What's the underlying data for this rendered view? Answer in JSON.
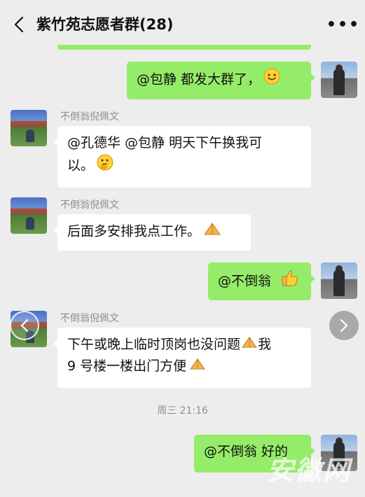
{
  "header": {
    "title": "紫竹苑志愿者群(28)",
    "more": "•••"
  },
  "messages": [
    {
      "side": "right",
      "text": "@包静  都发大群了，",
      "emoji": "smile-emoji"
    },
    {
      "side": "left",
      "sender": "不倒翁倪佩文",
      "line1": "@孔德华 @包静  明天下午换我可",
      "line2": "以。",
      "emoji": "thinking-emoji"
    },
    {
      "side": "left",
      "sender": "不倒翁倪佩文",
      "text": "后面多安排我点工作。",
      "emoji": "praying-hands-emoji"
    },
    {
      "side": "right",
      "text": "@不倒翁",
      "emoji": "thumbs-up-emoji"
    },
    {
      "side": "left",
      "sender": "不倒翁倪佩文",
      "line1": "下午或晚上临时顶岗也没问题",
      "line1_tail": "我",
      "line2": "9 号楼一楼出门方便",
      "emoji": "praying-hands-emoji"
    },
    {
      "side": "right",
      "text": "@不倒翁  好的"
    }
  ],
  "timestamp": "周三 21:16",
  "watermark": "安徽网"
}
